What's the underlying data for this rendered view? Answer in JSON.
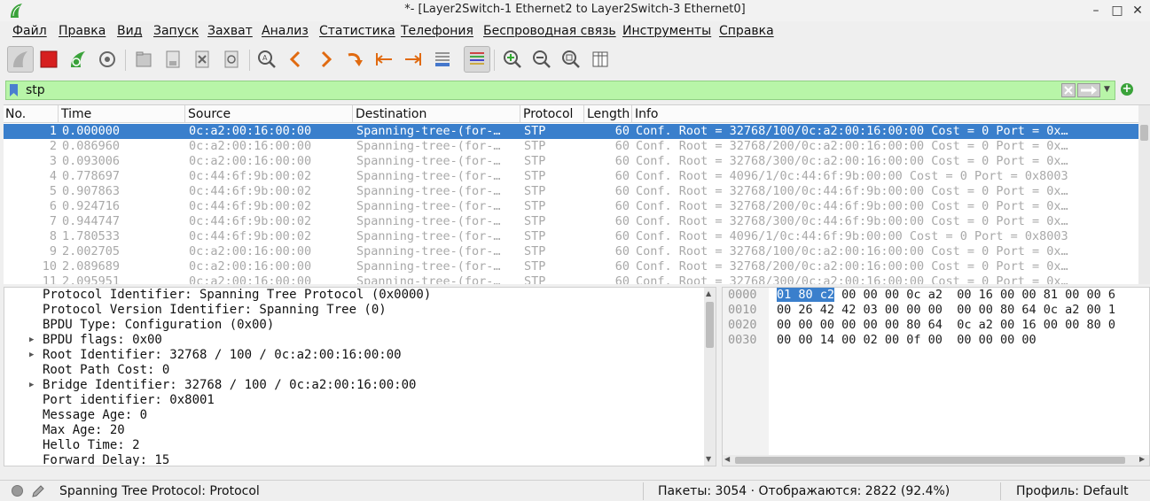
{
  "window": {
    "title": "*- [Layer2Switch-1 Ethernet2 to Layer2Switch-3 Ethernet0]"
  },
  "menu": [
    "Файл",
    "Правка",
    "Вид",
    "Запуск",
    "Захват",
    "Анализ",
    "Статистика",
    "Телефония",
    "Беспроводная связь",
    "Инструменты",
    "Справка"
  ],
  "toolbar": {
    "icons": [
      "shark-fin-start-icon",
      "stop-icon",
      "restart-capture-icon",
      "capture-options-gear-icon",
      "open-folder-icon",
      "save-file-icon",
      "close-file-icon",
      "reload-icon",
      "find-packet-icon",
      "go-back-icon",
      "go-forward-icon",
      "go-to-packet-icon",
      "go-first-icon",
      "go-last-icon",
      "autoscroll-icon",
      "colorize-icon",
      "zoom-in-icon",
      "zoom-out-icon",
      "zoom-normal-icon",
      "resize-columns-icon"
    ]
  },
  "filter": {
    "value": "stp",
    "accent": "#b8f5a8"
  },
  "packet_list": {
    "columns": [
      "No.",
      "Time",
      "Source",
      "Destination",
      "Protocol",
      "Length",
      "Info"
    ],
    "rows": [
      [
        "1",
        "0.000000",
        "0c:a2:00:16:00:00",
        "Spanning-tree-(for-…",
        "STP",
        "60",
        "Conf. Root = 32768/100/0c:a2:00:16:00:00  Cost = 0  Port = 0x…"
      ],
      [
        "2",
        "0.086960",
        "0c:a2:00:16:00:00",
        "Spanning-tree-(for-…",
        "STP",
        "60",
        "Conf. Root = 32768/200/0c:a2:00:16:00:00  Cost = 0  Port = 0x…"
      ],
      [
        "3",
        "0.093006",
        "0c:a2:00:16:00:00",
        "Spanning-tree-(for-…",
        "STP",
        "60",
        "Conf. Root = 32768/300/0c:a2:00:16:00:00  Cost = 0  Port = 0x…"
      ],
      [
        "4",
        "0.778697",
        "0c:44:6f:9b:00:02",
        "Spanning-tree-(for-…",
        "STP",
        "60",
        "Conf. Root = 4096/1/0c:44:6f:9b:00:00  Cost = 0  Port = 0x8003"
      ],
      [
        "5",
        "0.907863",
        "0c:44:6f:9b:00:02",
        "Spanning-tree-(for-…",
        "STP",
        "60",
        "Conf. Root = 32768/100/0c:44:6f:9b:00:00  Cost = 0  Port = 0x…"
      ],
      [
        "6",
        "0.924716",
        "0c:44:6f:9b:00:02",
        "Spanning-tree-(for-…",
        "STP",
        "60",
        "Conf. Root = 32768/200/0c:44:6f:9b:00:00  Cost = 0  Port = 0x…"
      ],
      [
        "7",
        "0.944747",
        "0c:44:6f:9b:00:02",
        "Spanning-tree-(for-…",
        "STP",
        "60",
        "Conf. Root = 32768/300/0c:44:6f:9b:00:00  Cost = 0  Port = 0x…"
      ],
      [
        "8",
        "1.780533",
        "0c:44:6f:9b:00:02",
        "Spanning-tree-(for-…",
        "STP",
        "60",
        "Conf. Root = 4096/1/0c:44:6f:9b:00:00  Cost = 0  Port = 0x8003"
      ],
      [
        "9",
        "2.002705",
        "0c:a2:00:16:00:00",
        "Spanning-tree-(for-…",
        "STP",
        "60",
        "Conf. Root = 32768/100/0c:a2:00:16:00:00  Cost = 0  Port = 0x…"
      ],
      [
        "10",
        "2.089689",
        "0c:a2:00:16:00:00",
        "Spanning-tree-(for-…",
        "STP",
        "60",
        "Conf. Root = 32768/200/0c:a2:00:16:00:00  Cost = 0  Port = 0x…"
      ],
      [
        "11",
        "2.095951",
        "0c:a2:00:16:00:00",
        "Spanning-tree-(for-…",
        "STP",
        "60",
        "Conf. Root = 32768/300/0c:a2:00:16:00:00  Cost = 0  Port = 0x…"
      ]
    ],
    "selected_index": 0
  },
  "details": [
    {
      "text": "Protocol Identifier: Spanning Tree Protocol (0x0000)",
      "expandable": false
    },
    {
      "text": "Protocol Version Identifier: Spanning Tree (0)",
      "expandable": false
    },
    {
      "text": "BPDU Type: Configuration (0x00)",
      "expandable": false
    },
    {
      "text": "BPDU flags: 0x00",
      "expandable": true
    },
    {
      "text": "Root Identifier: 32768 / 100 / 0c:a2:00:16:00:00",
      "expandable": true
    },
    {
      "text": "Root Path Cost: 0",
      "expandable": false
    },
    {
      "text": "Bridge Identifier: 32768 / 100 / 0c:a2:00:16:00:00",
      "expandable": true
    },
    {
      "text": "Port identifier: 0x8001",
      "expandable": false
    },
    {
      "text": "Message Age: 0",
      "expandable": false
    },
    {
      "text": "Max Age: 20",
      "expandable": false
    },
    {
      "text": "Hello Time: 2",
      "expandable": false
    },
    {
      "text": "Forward Delay: 15",
      "expandable": false
    }
  ],
  "hex": {
    "offsets": [
      "0000",
      "0010",
      "0020",
      "0030"
    ],
    "selected": "01 80 c2",
    "rows": [
      " 00 00 00 0c a2  00 16 00 00 81 00 00 6",
      "00 26 42 42 03 00 00 00  00 00 80 64 0c a2 00 1",
      "00 00 00 00 00 00 80 64  0c a2 00 16 00 00 80 0",
      "00 00 14 00 02 00 0f 00  00 00 00 00"
    ]
  },
  "status": {
    "protocol": "Spanning Tree Protocol: Protocol",
    "packets": "Пакеты: 3054 · Отображаются: 2822 (92.4%)",
    "profile": "Профиль: Default"
  }
}
